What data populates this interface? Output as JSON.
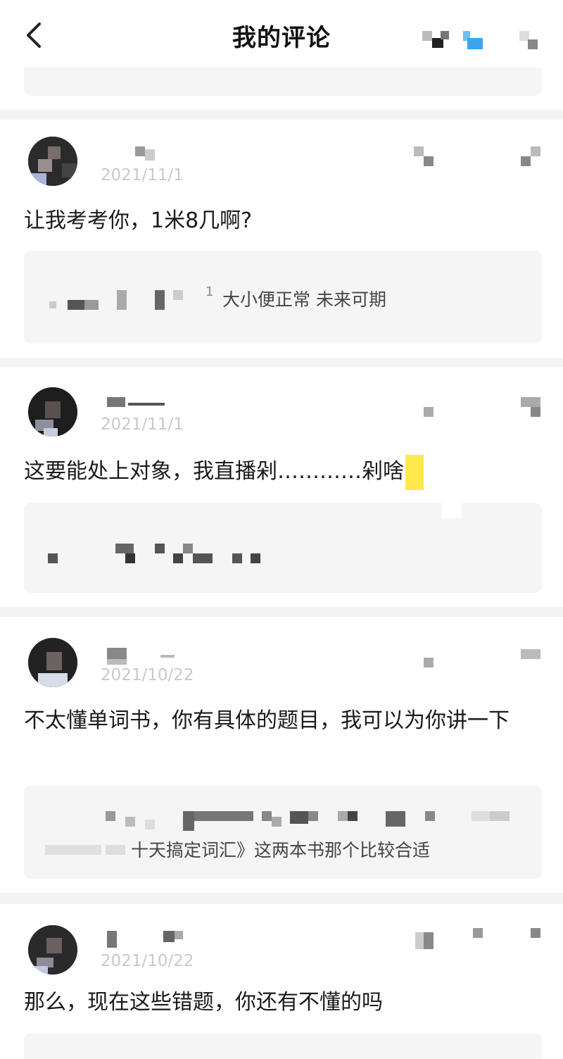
{
  "header": {
    "title": "我的评论",
    "back_icon": "chevron-left-icon"
  },
  "comments": [
    {
      "date": "2021/11/1",
      "text": "让我考考你，1米8几啊?",
      "quote_prefix": "1",
      "quote": "大小便正常 未来可期"
    },
    {
      "date": "2021/11/1",
      "text": "这要能处上对象，我直播剁…………剁啥",
      "quote": ""
    },
    {
      "date": "2021/10/22",
      "text": "不太懂单词书，你有具体的题目，我可以为你讲一下",
      "quote": "十天搞定词汇》这两本书那个比较合适"
    },
    {
      "date": "2021/10/22",
      "text": "那么，现在这些错题，你还有不懂的吗",
      "quote": ""
    }
  ],
  "colors": {
    "background": "#f4f4f4",
    "card": "#ffffff",
    "quote_bg": "#f5f5f5",
    "date": "#c9c9c9",
    "highlight": "#ffe94d"
  }
}
